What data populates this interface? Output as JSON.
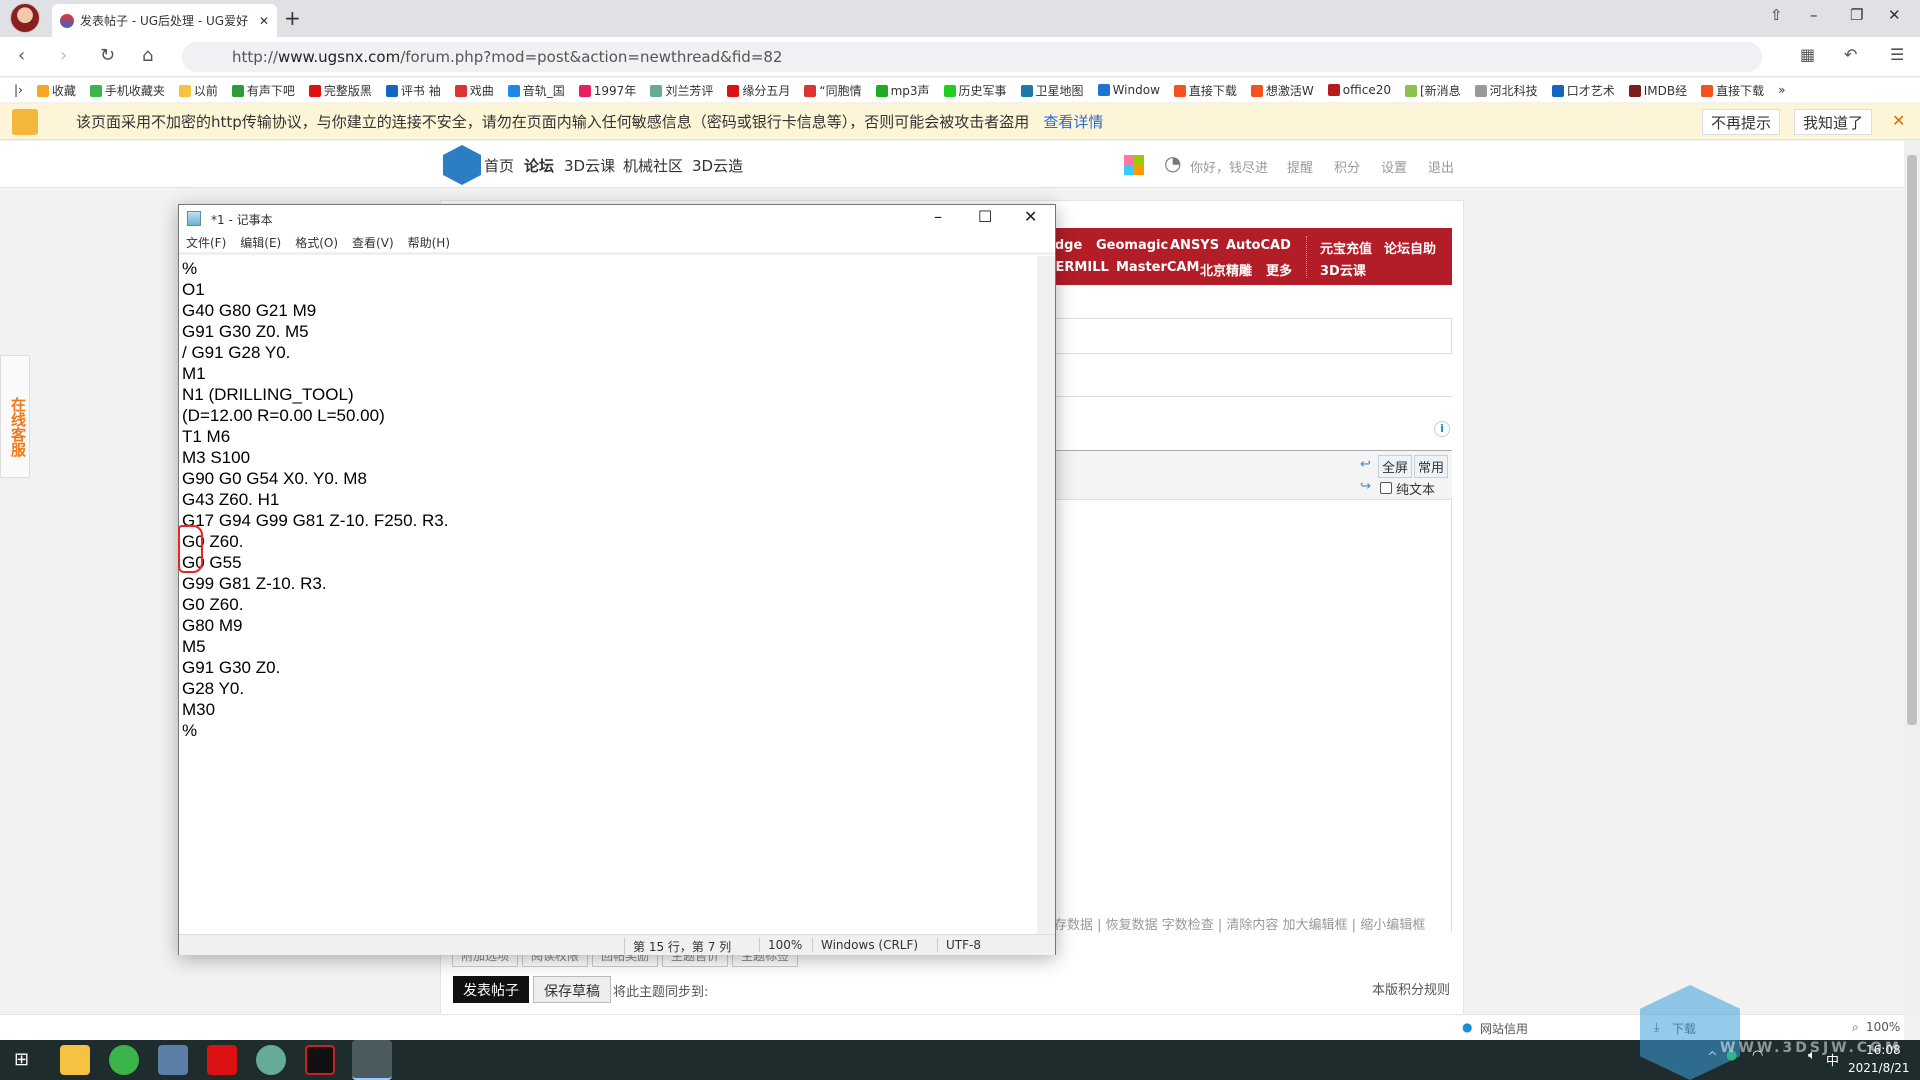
{
  "browser": {
    "tab_title": "发表帖子 - UG后处理 - UG爱好",
    "url_prefix": "http://",
    "url_host": "www.ugsnx.com",
    "url_path": "/forum.php?mod=post&action=newthread&fid=82",
    "bookmarks": [
      "收藏",
      "手机收藏夹",
      "以前",
      "有声下吧",
      "完整版黑",
      "评书 袖",
      "戏曲",
      "音轨_国",
      "1997年",
      "刘兰芳评",
      "缘分五月",
      "“同胞情",
      "mp3声",
      "历史军事",
      "卫星地图",
      "Window",
      "直接下载",
      "想激活W",
      "office20",
      "[新消息",
      "河北科技",
      "口才艺术",
      "IMDB经",
      "直接下载",
      "»"
    ],
    "security_banner": "该页面采用不加密的http传输协议，与你建立的连接不安全，请勿在页面内输入任何敏感信息（密码或银行卡信息等），否则可能会被攻击者盗用",
    "banner_link": "查看详情",
    "banner_btn_no": "不再提示",
    "banner_btn_ok": "我知道了",
    "status_items": [
      "网站信用",
      "下载",
      "100%"
    ]
  },
  "site": {
    "nav": [
      "首页",
      "论坛",
      "3D云课",
      "机械社区",
      "3D云造"
    ],
    "user": [
      "你好，钱尽进",
      "提醒",
      "积分",
      "设置",
      "退出"
    ],
    "rednav_row1": [
      "Edge",
      "Geomagic",
      "ANSYS",
      "AutoCAD",
      "元宝充值",
      "论坛自助"
    ],
    "rednav_row2": [
      "PERMILL",
      "MasterCAM",
      "北京精雕",
      "更多",
      "3D云课"
    ],
    "float_service": "在线客服",
    "editor": {
      "fullscreen": "全屏",
      "common": "常用",
      "plain_text": "纯文本",
      "footer": "存数据 | 恢复数据    字数检查 | 清除内容    加大编辑框 | 缩小编辑框",
      "tabs": [
        "附加选项",
        "阅读权限",
        "回帖奖励",
        "主题售价",
        "主题标签"
      ]
    },
    "submit": "发表帖子",
    "save_draft": "保存草稿",
    "sync_label": "将此主题同步到:",
    "rules": "本版积分规则"
  },
  "notepad": {
    "title": "*1 - 记事本",
    "menu": [
      "文件(F)",
      "编辑(E)",
      "格式(O)",
      "查看(V)",
      "帮助(H)"
    ],
    "lines": [
      "%",
      "O1",
      "G40 G80 G21 M9",
      "G91 G30 Z0. M5",
      "/ G91 G28 Y0.",
      "M1",
      "N1 (DRILLING_TOOL)",
      "(D=12.00 R=0.00 L=50.00)",
      "T1 M6",
      "M3 S100",
      "G90 G0 G54 X0. Y0. M8",
      "G43 Z60. H1",
      "G17 G94 G99 G81 Z-10. F250. R3.",
      "G0 Z60.",
      "G0 G55",
      "G99 G81 Z-10. R3.",
      "G0 Z60.",
      "G80 M9",
      "M5",
      "G91 G30 Z0.",
      "G28 Y0.",
      "M30",
      "%"
    ],
    "status": {
      "position": "第 15 行，第 7 列",
      "zoom": "100%",
      "eol": "Windows (CRLF)",
      "encoding": "UTF-8"
    }
  },
  "taskbar": {
    "ime": "中",
    "time": "16:08",
    "date": "2021/8/21",
    "watermark": "WWW.3DSJW.COM"
  },
  "colors": {
    "brand_red": "#b21d27",
    "taskbar": "#1f2c2e",
    "banner": "#fdf5d8",
    "link": "#2a6bd1"
  }
}
